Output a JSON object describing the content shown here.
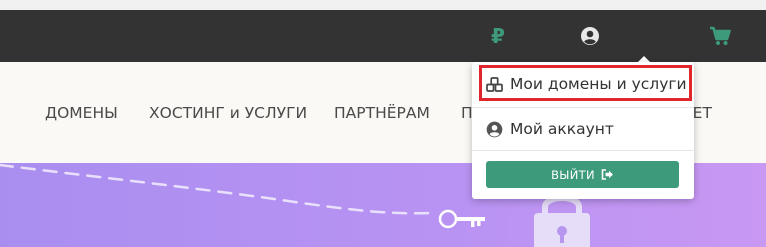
{
  "topbar": {
    "currency_icon": "ruble-icon",
    "currency_symbol": "₽",
    "user_icon": "user-circle-icon",
    "cart_icon": "cart-icon"
  },
  "nav": {
    "items": [
      "ДОМЕНЫ",
      "ХОСТИНГ и УСЛУГИ",
      "ПАРТНЁРАМ",
      "П",
      "НЕТ"
    ]
  },
  "dropdown": {
    "items": [
      {
        "label": "Мои домены и услуги",
        "icon": "cubes-icon"
      },
      {
        "label": "Мой аккаунт",
        "icon": "user-circle-icon"
      }
    ],
    "logout_label": "ВЫЙТИ",
    "logout_icon": "sign-out-icon"
  },
  "colors": {
    "topbar_bg": "#333333",
    "accent_green": "#3d9a7a",
    "highlight_red": "#e0262c",
    "hero_purple": "#b48ff2"
  }
}
